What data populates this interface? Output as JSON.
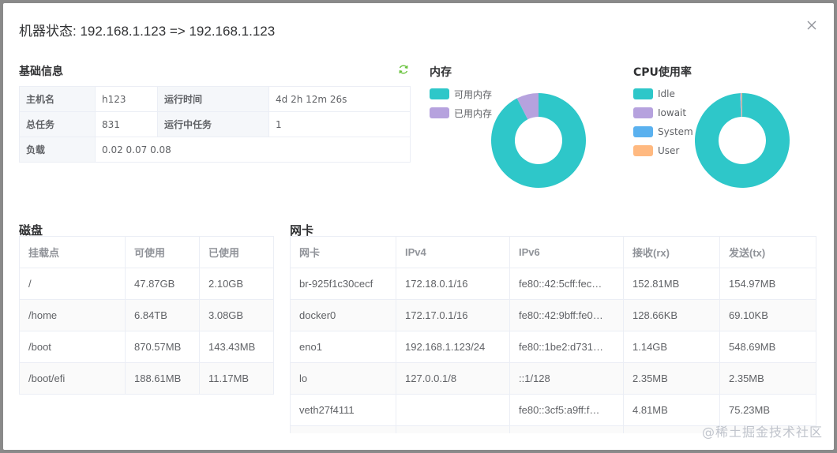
{
  "dialog": {
    "title": "机器状态: 192.168.1.123 => 192.168.1.123",
    "close_icon": "close-icon"
  },
  "basic_info": {
    "title": "基础信息",
    "refresh_icon": "refresh-icon",
    "rows": [
      [
        {
          "label": "主机名",
          "value": "h123"
        },
        {
          "label": "运行时间",
          "value": "4d 2h 12m 26s"
        }
      ],
      [
        {
          "label": "总任务",
          "value": "831"
        },
        {
          "label": "运行中任务",
          "value": "1"
        }
      ],
      [
        {
          "label": "负载",
          "value": "0.02 0.07 0.08"
        }
      ]
    ]
  },
  "memory": {
    "title": "内存",
    "legend": [
      {
        "label": "可用内存",
        "color": "#2ec7c9"
      },
      {
        "label": "已用内存",
        "color": "#b6a2de"
      }
    ],
    "chart_data": {
      "type": "pie",
      "categories": [
        "可用内存",
        "已用内存"
      ],
      "values": [
        92.5,
        7.5
      ]
    }
  },
  "cpu": {
    "title": "CPU使用率",
    "legend": [
      {
        "label": "Idle",
        "color": "#2ec7c9"
      },
      {
        "label": "Iowait",
        "color": "#b6a2de"
      },
      {
        "label": "System",
        "color": "#5ab1ef"
      },
      {
        "label": "User",
        "color": "#ffb980"
      }
    ],
    "chart_data": {
      "type": "pie",
      "categories": [
        "Idle",
        "Iowait",
        "System",
        "User"
      ],
      "values": [
        99.2,
        0.1,
        0.35,
        0.35
      ]
    }
  },
  "disk": {
    "title": "磁盘",
    "headers": [
      "挂载点",
      "可使用",
      "已使用"
    ],
    "rows": [
      [
        "/",
        "47.87GB",
        "2.10GB"
      ],
      [
        "/home",
        "6.84TB",
        "3.08GB"
      ],
      [
        "/boot",
        "870.57MB",
        "143.43MB"
      ],
      [
        "/boot/efi",
        "188.61MB",
        "11.17MB"
      ]
    ]
  },
  "nic": {
    "title": "网卡",
    "headers": [
      "网卡",
      "IPv4",
      "IPv6",
      "接收(rx)",
      "发送(tx)"
    ],
    "rows": [
      [
        "br-925f1c30cecf",
        "172.18.0.1/16",
        "fe80::42:5cff:fec…",
        "152.81MB",
        "154.97MB"
      ],
      [
        "docker0",
        "172.17.0.1/16",
        "fe80::42:9bff:fe0…",
        "128.66KB",
        "69.10KB"
      ],
      [
        "eno1",
        "192.168.1.123/24",
        "fe80::1be2:d731…",
        "1.14GB",
        "548.69MB"
      ],
      [
        "lo",
        "127.0.0.1/8",
        "::1/128",
        "2.35MB",
        "2.35MB"
      ],
      [
        "veth27f4111",
        "",
        "fe80::3cf5:a9ff:f…",
        "4.81MB",
        "75.23MB"
      ],
      [
        "",
        "",
        "",
        "",
        ""
      ]
    ]
  },
  "watermark": "@稀土掘金技术社区"
}
